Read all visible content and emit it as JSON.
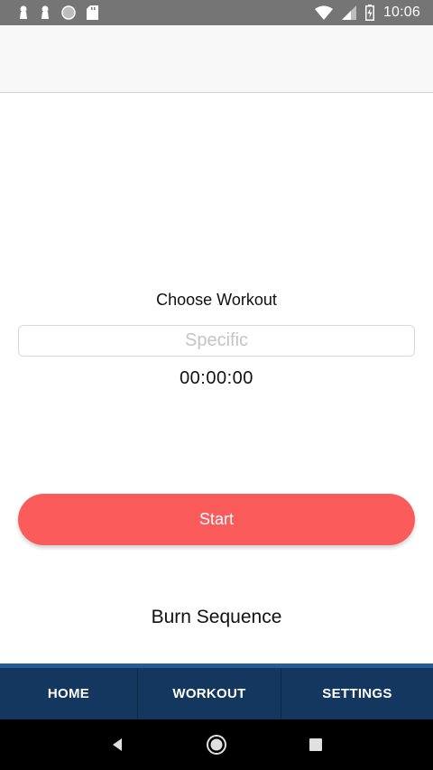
{
  "status_bar": {
    "time": "10:06",
    "icons": [
      "keyhole-icon",
      "keyhole-icon",
      "circle-icon",
      "sd-card-icon",
      "wifi-icon",
      "signal-icon",
      "battery-icon"
    ]
  },
  "main": {
    "choose_label": "Choose Workout",
    "workout_input": {
      "value": "",
      "placeholder": "Specific"
    },
    "timer": "00:00:00",
    "start_label": "Start",
    "sequence_title": "Burn Sequence"
  },
  "tabs": [
    {
      "label": "HOME"
    },
    {
      "label": "WORKOUT"
    },
    {
      "label": "SETTINGS"
    }
  ],
  "colors": {
    "accent": "#fb5b5a",
    "tab_bar": "#14375f",
    "status_bar": "#757575"
  }
}
